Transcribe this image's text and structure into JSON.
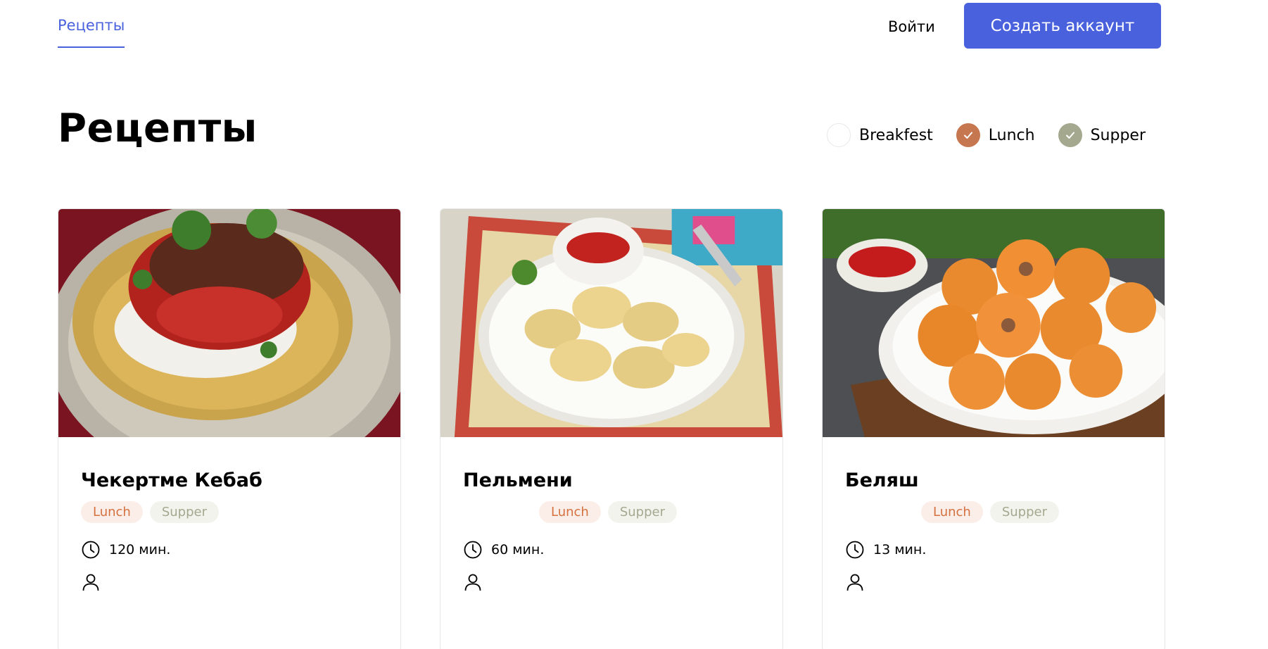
{
  "header": {
    "nav_label": "Рецепты",
    "login_label": "Войти",
    "signup_label": "Создать аккаунт"
  },
  "page": {
    "title": "Рецепты"
  },
  "filters": [
    {
      "label": "Breakfest",
      "checked": false,
      "color": "#ffffff"
    },
    {
      "label": "Lunch",
      "checked": true,
      "color": "#c7774f"
    },
    {
      "label": "Supper",
      "checked": true,
      "color": "#a4a88e"
    }
  ],
  "cards": [
    {
      "title": "Чекертме Кебаб",
      "tags": [
        "Lunch",
        "Supper"
      ],
      "time": "120 мин.",
      "image_icon": "kebab-dish-image"
    },
    {
      "title": "Пельмени",
      "tags": [
        "Lunch",
        "Supper"
      ],
      "time": "60 мин.",
      "image_icon": "dumplings-image"
    },
    {
      "title": "Беляш",
      "tags": [
        "Lunch",
        "Supper"
      ],
      "time": "13 мин.",
      "image_icon": "belyash-image"
    }
  ],
  "colors": {
    "accent": "#4a61dd",
    "lunch_tag_bg": "#fbeee8",
    "lunch_tag_text": "#d5703f",
    "supper_tag_bg": "#f3f3ee",
    "supper_tag_text": "#a4a88e"
  }
}
